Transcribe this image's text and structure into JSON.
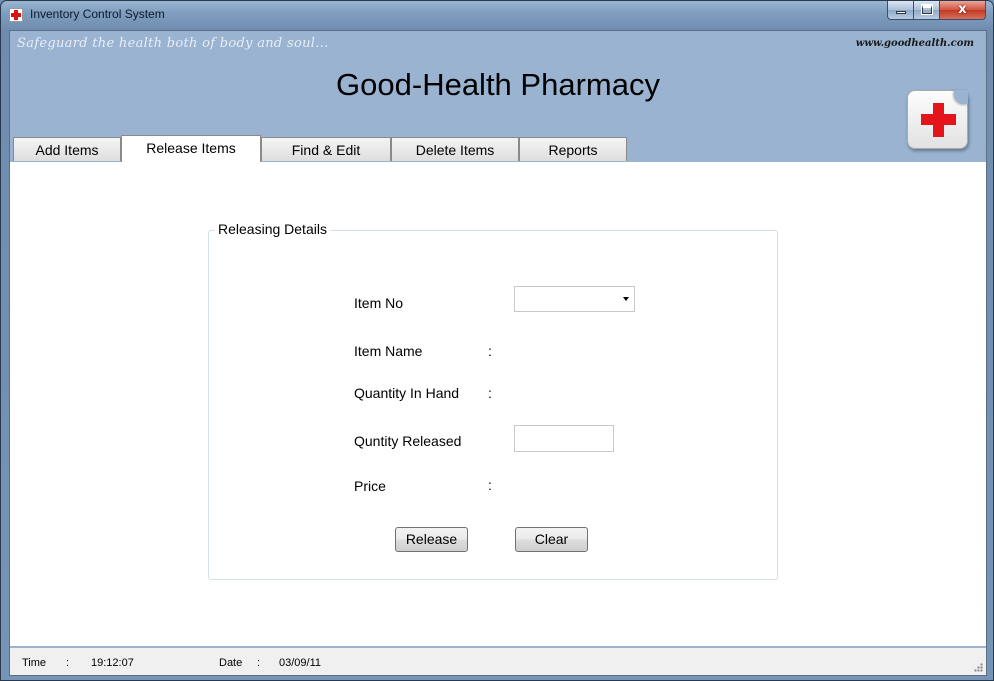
{
  "window": {
    "title": "Inventory Control System",
    "close_glyph": "x"
  },
  "header": {
    "tagline": "Safeguard the health both of body and soul...",
    "website": "www.goodhealth.com",
    "title": "Good-Health Pharmacy",
    "logo_icon": "red-cross-icon"
  },
  "tabs": [
    {
      "label": "Add Items"
    },
    {
      "label": "Release Items",
      "active": true
    },
    {
      "label": "Find & Edit"
    },
    {
      "label": "Delete Items"
    },
    {
      "label": "Reports"
    }
  ],
  "form": {
    "legend": "Releasing Details",
    "item_no_label": "Item No",
    "item_no_value": "",
    "item_name_label": "Item Name",
    "quantity_in_hand_label": "Quantity In Hand",
    "quantity_released_label": "Quntity Released",
    "quantity_released_value": "",
    "price_label": "Price",
    "colon": ":",
    "release_button": "Release",
    "clear_button": "Clear"
  },
  "status": {
    "time_label": "Time",
    "time_value": "19:12:07",
    "date_label": "Date",
    "date_value": "03/09/11",
    "colon": ":"
  },
  "colors": {
    "header_bg": "#99b3d1",
    "cross_red": "#e3141a"
  }
}
